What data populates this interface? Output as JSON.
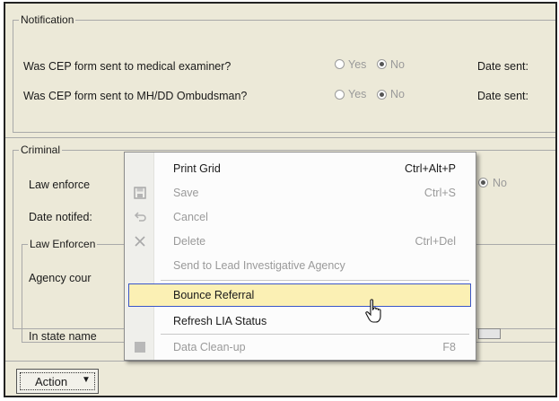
{
  "notification": {
    "title": "Notification",
    "q1": "Was CEP form sent to medical examiner?",
    "q2": "Was CEP form sent to MH/DD Ombudsman?",
    "yes": "Yes",
    "no": "No",
    "date_sent": "Date sent:"
  },
  "criminal": {
    "title": "Criminal",
    "law_enforcement": "Law enforce",
    "no": "No",
    "date_notified": "Date notifed:"
  },
  "law_enforcement_box": {
    "title": "Law Enforcen",
    "agency": "Agency cour",
    "in_state": "In state name"
  },
  "context_menu": {
    "items": [
      {
        "label": "Print Grid",
        "shortcut": "Ctrl+Alt+P",
        "enabled": true,
        "icon": "none"
      },
      {
        "label": "Save",
        "shortcut": "Ctrl+S",
        "enabled": false,
        "icon": "floppy-icon"
      },
      {
        "label": "Cancel",
        "shortcut": "",
        "enabled": false,
        "icon": "undo-icon"
      },
      {
        "label": "Delete",
        "shortcut": "Ctrl+Del",
        "enabled": false,
        "icon": "x-icon"
      },
      {
        "label": "Send to Lead Investigative Agency",
        "shortcut": "",
        "enabled": false,
        "icon": "none"
      },
      {
        "label": "Bounce Referral",
        "shortcut": "",
        "enabled": true,
        "icon": "none",
        "highlighted": true
      },
      {
        "label": "Refresh LIA Status",
        "shortcut": "",
        "enabled": true,
        "icon": "none"
      },
      {
        "label": "Data Clean-up",
        "shortcut": "F8",
        "enabled": false,
        "icon": "grid-icon"
      }
    ]
  },
  "action_button": {
    "label": "Action",
    "arrow": "▼"
  },
  "colors": {
    "highlight_bg": "#fbf0b4",
    "highlight_border": "#3a56c8",
    "panel_bg": "#ece9d8"
  }
}
